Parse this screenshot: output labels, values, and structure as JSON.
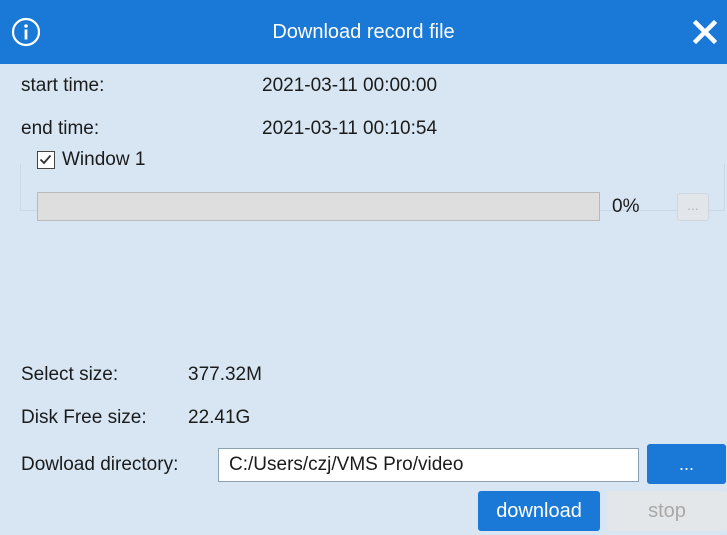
{
  "dialog": {
    "title": "Download record file",
    "info_icon": "info-circle-icon",
    "close_icon": "close-x-icon"
  },
  "fields": {
    "start_time_label": "start time:",
    "start_time_value": "2021-03-11 00:00:00",
    "end_time_label": "end time:",
    "end_time_value": "2021-03-11 00:10:54"
  },
  "window": {
    "label": "Window 1",
    "checked": true,
    "progress_percent": 0,
    "progress_text": "0%",
    "more_label": "..."
  },
  "size": {
    "select_label": "Select size:",
    "select_value": "377.32M",
    "disk_label": "Disk Free size:",
    "disk_value": "22.41G"
  },
  "directory": {
    "label": "Dowload directory:",
    "value": "C:/Users/czj/VMS Pro/video",
    "browse_label": "..."
  },
  "actions": {
    "download_label": "download",
    "stop_label": "stop"
  },
  "colors": {
    "accent": "#1a78d6",
    "background": "#d7e6f2",
    "disabled": "#e4e7ea"
  }
}
